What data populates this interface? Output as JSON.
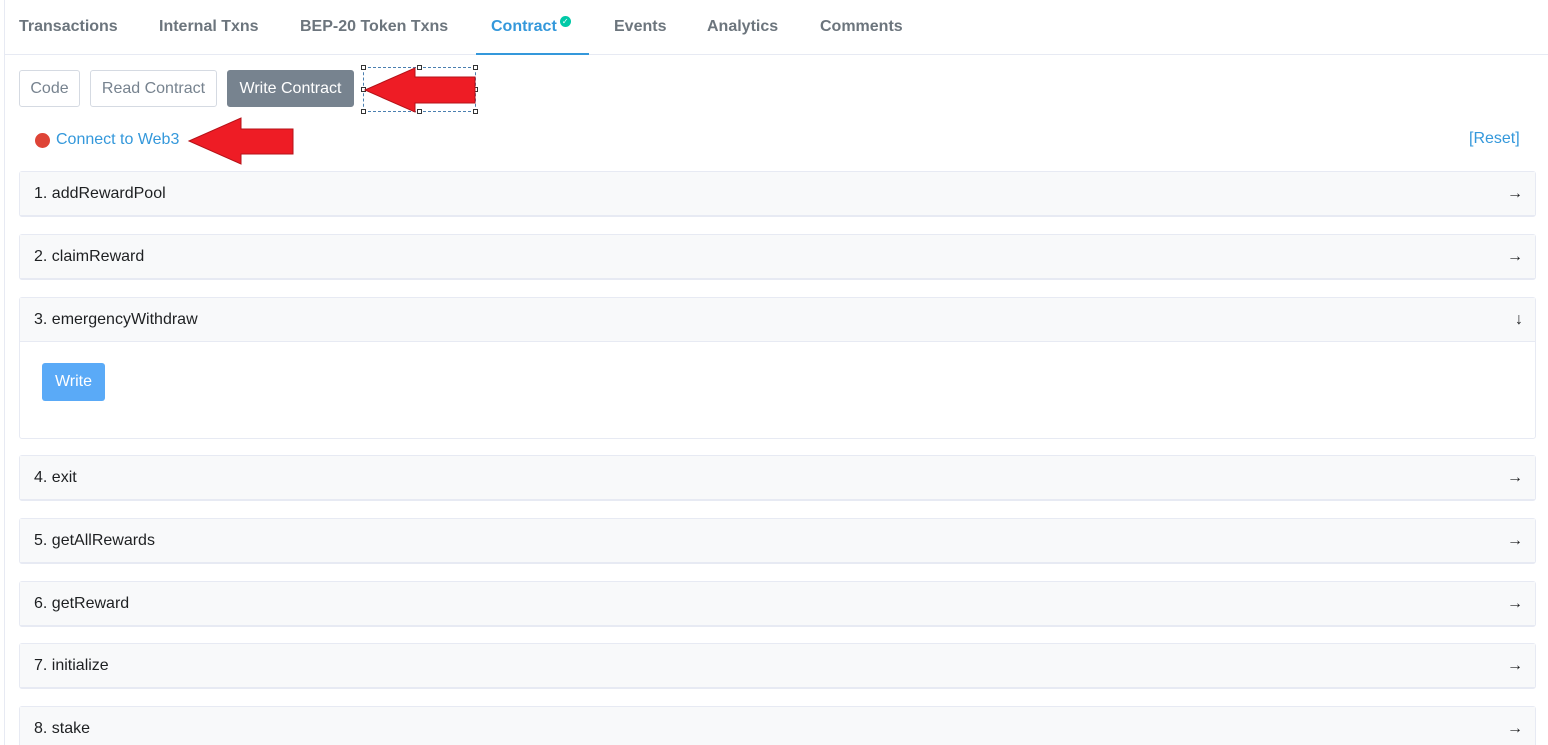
{
  "tabs": [
    {
      "label": "Transactions"
    },
    {
      "label": "Internal Txns"
    },
    {
      "label": "BEP-20 Token Txns"
    },
    {
      "label": "Contract"
    },
    {
      "label": "Events"
    },
    {
      "label": "Analytics"
    },
    {
      "label": "Comments"
    }
  ],
  "contract_tabs": [
    {
      "label": "Code"
    },
    {
      "label": "Read Contract"
    },
    {
      "label": "Write Contract"
    }
  ],
  "connect": {
    "label": "Connect to Web3"
  },
  "reset_label": "[Reset]",
  "functions": [
    {
      "label": "1. addRewardPool"
    },
    {
      "label": "2. claimReward"
    },
    {
      "label": "3. emergencyWithdraw"
    },
    {
      "label": "4. exit"
    },
    {
      "label": "5. getAllRewards"
    },
    {
      "label": "6. getReward"
    },
    {
      "label": "7. initialize"
    },
    {
      "label": "8. stake"
    }
  ],
  "write_button_label": "Write",
  "icons": {
    "collapsed": "→",
    "expanded": "↓",
    "verified": "✓"
  },
  "colors": {
    "accent": "#3498db",
    "annotation_arrow": "#ee1c25",
    "status_dot": "#de4437",
    "write_button": "#5aaaf7"
  }
}
